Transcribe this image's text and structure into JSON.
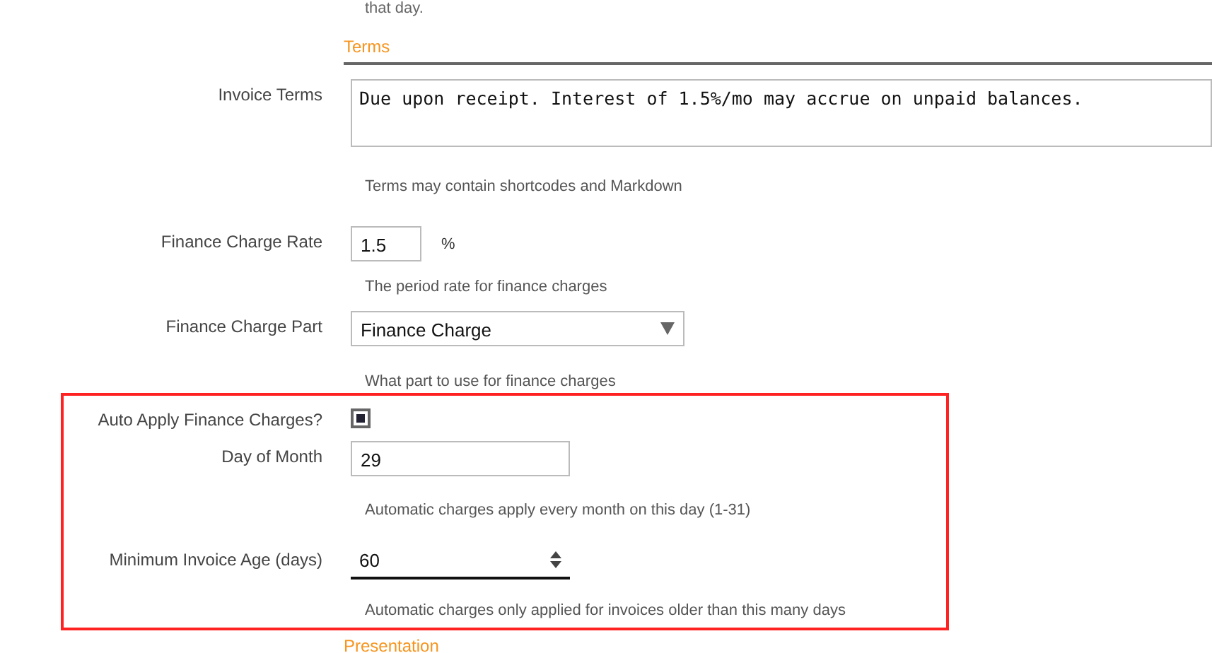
{
  "previous_hint": "that day.",
  "section": {
    "title": "Terms"
  },
  "fields": [
    {
      "kind": "textarea",
      "label": "Invoice Terms",
      "value": "Due upon receipt. Interest of 1.5%/mo may accrue on unpaid balances.",
      "hint": "Terms may contain shortcodes and Markdown"
    },
    {
      "kind": "number",
      "label": "Finance Charge Rate",
      "value": "1.5",
      "unit": "%",
      "hint": "The period rate for finance charges"
    },
    {
      "kind": "select",
      "label": "Finance Charge Part",
      "value": "Finance Charge",
      "hint": "What part to use for finance charges"
    },
    {
      "kind": "checkbox",
      "label": "Auto Apply Finance Charges?",
      "checked": true,
      "highlighted": true
    },
    {
      "kind": "text",
      "label": "Day of Month",
      "value": "29",
      "hint": "Automatic charges apply every month on this day (1-31)",
      "highlighted": true
    },
    {
      "kind": "spinner",
      "label": "Minimum Invoice Age (days)",
      "value": "60",
      "hint": "Automatic charges only applied for invoices older than this many days",
      "highlighted": true
    }
  ],
  "next_section": {
    "title": "Presentation"
  }
}
